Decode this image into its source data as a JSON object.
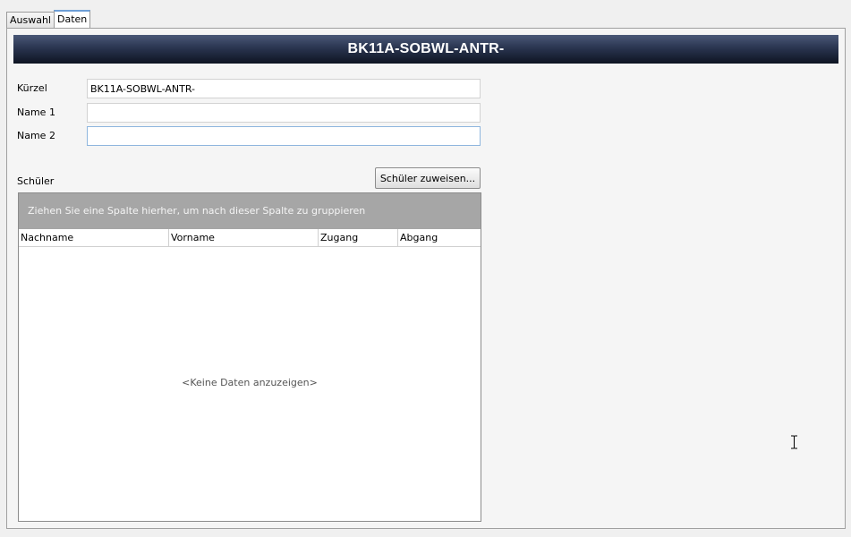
{
  "tabs": [
    {
      "label": "Auswahl",
      "active": false
    },
    {
      "label": "Daten",
      "active": true
    }
  ],
  "header": {
    "title": "BK11A-SOBWL-ANTR-"
  },
  "form": {
    "kuerzel": {
      "label": "Kürzel",
      "value": "BK11A-SOBWL-ANTR-"
    },
    "name1": {
      "label": "Name 1",
      "value": ""
    },
    "name2": {
      "label": "Name 2",
      "value": ""
    }
  },
  "students": {
    "section_label": "Schüler",
    "assign_button_label": "Schüler zuweisen...",
    "group_panel_text": "Ziehen Sie eine Spalte hierher, um nach dieser Spalte zu gruppieren",
    "columns": [
      "Nachname",
      "Vorname",
      "Zugang",
      "Abgang"
    ],
    "rows": [],
    "empty_text": "<Keine Daten anzuzeigen>"
  },
  "colors": {
    "title_bar": "#1a2236",
    "group_panel": "#a6a6a6",
    "active_tab_accent": "#6e9fd6"
  },
  "icons": {
    "cursor": "text-cursor-icon"
  }
}
